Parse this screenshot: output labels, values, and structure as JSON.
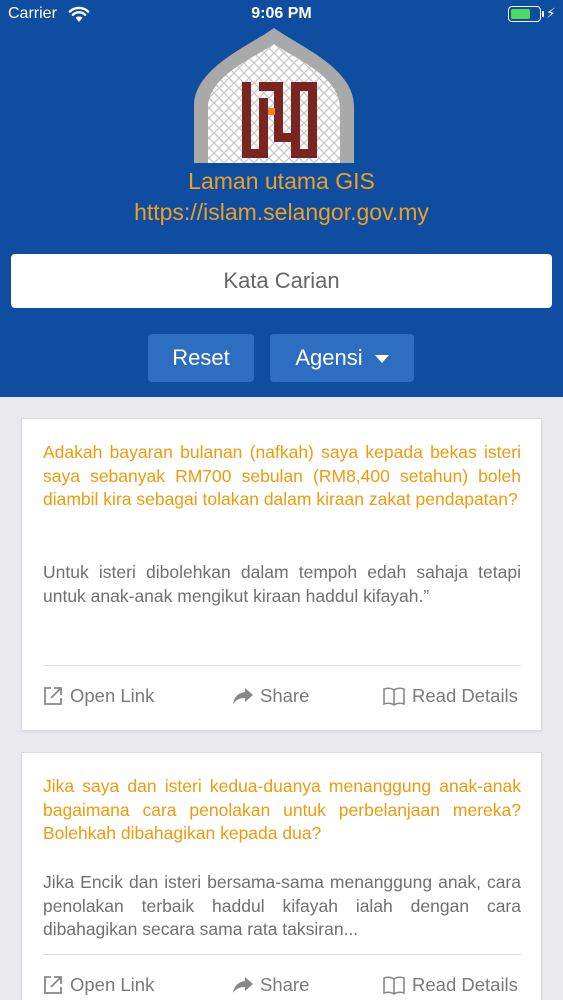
{
  "status_bar": {
    "carrier": "Carrier",
    "time": "9:06 PM",
    "battery_level": 0.7,
    "battery_color": "#4cd964"
  },
  "header": {
    "background_color": "#0f4da1",
    "logo_icon": "mosque-dome-logo-icon",
    "title": "Laman utama GIS",
    "url": "https://islam.selangor.gov.my",
    "accent_color": "#f0a020"
  },
  "search": {
    "placeholder": "Kata Carian",
    "value": ""
  },
  "buttons": {
    "reset_label": "Reset",
    "agensi_label": "Agensi"
  },
  "cards": [
    {
      "question": "Adakah bayaran bulanan (nafkah) saya kepada bekas isteri saya sebanyak RM700 sebulan (RM8,400 setahun) boleh diambil kira sebagai tolakan dalam kiraan zakat pendapatan?",
      "answer": "Untuk isteri dibolehkan dalam tempoh edah sahaja tetapi untuk anak-anak mengikut kiraan haddul kifayah.”",
      "open_link_label": "Open Link",
      "share_label": "Share",
      "read_details_label": "Read Details"
    },
    {
      "question": "Jika saya dan isteri kedua-duanya menanggung anak-anak bagaimana cara penolakan untuk perbelanjaan mereka? Bolehkah dibahagikan kepada dua?",
      "answer": "Jika Encik dan isteri bersama-sama menanggung anak, cara penolakan terbaik haddul kifayah ialah dengan cara dibahagikan secara sama rata taksiran...",
      "open_link_label": "Open Link",
      "share_label": "Share",
      "read_details_label": "Read Details"
    }
  ]
}
